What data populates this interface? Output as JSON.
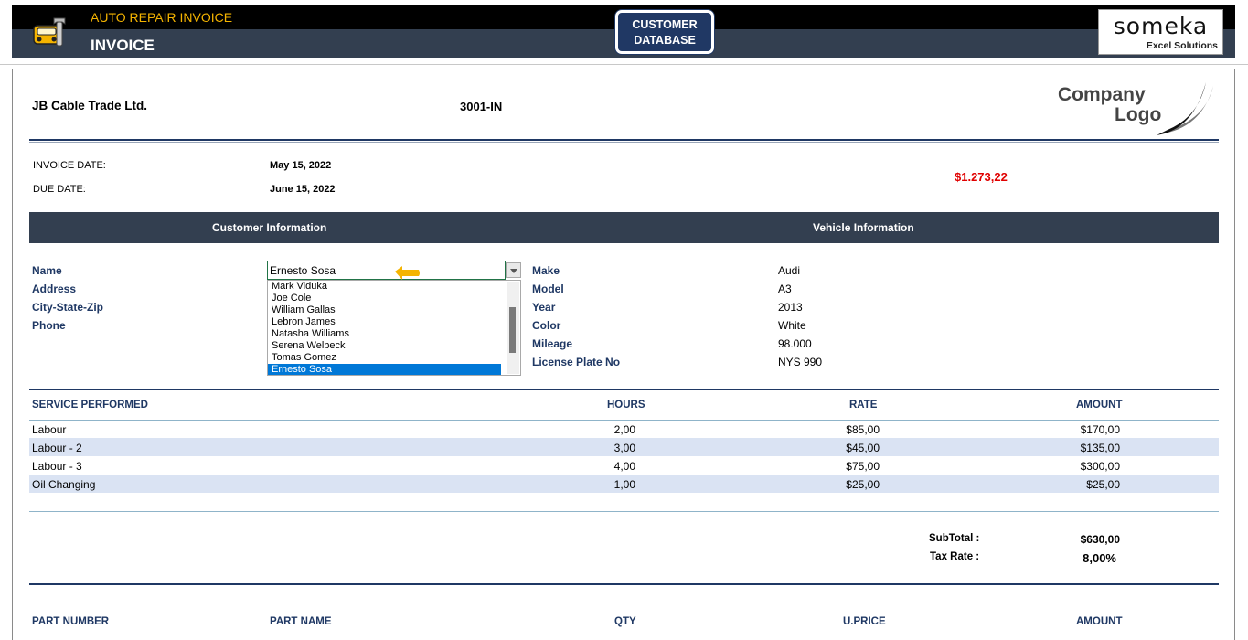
{
  "header": {
    "app_title": "AUTO REPAIR INVOICE",
    "page_name": "INVOICE",
    "customer_db_line1": "CUSTOMER",
    "customer_db_line2": "DATABASE",
    "brand_word": "someka",
    "brand_sub": "Excel Solutions"
  },
  "invoice": {
    "company": "JB Cable Trade Ltd.",
    "number": "3001-IN",
    "logo_line1": "Company",
    "logo_line2": "Logo",
    "date_label": "INVOICE DATE:",
    "date_value": "May 15, 2022",
    "due_label": "DUE DATE:",
    "due_value": "June 15, 2022",
    "total": "$1.273,22"
  },
  "sections": {
    "customer": "Customer Information",
    "vehicle": "Vehicle Information"
  },
  "customer": {
    "labels": [
      "Name",
      "Address",
      "City-State-Zip",
      "Phone"
    ],
    "name_value": "Ernesto Sosa",
    "dropdown_options": [
      "Mark Viduka",
      "Joe Cole",
      "William Gallas",
      "Lebron James",
      "Natasha Williams",
      "Serena Welbeck",
      "Tomas Gomez",
      "Ernesto Sosa"
    ],
    "selected_index": 7
  },
  "vehicle": {
    "fields": [
      {
        "label": "Make",
        "value": "Audi"
      },
      {
        "label": "Model",
        "value": "A3"
      },
      {
        "label": "Year",
        "value": "2013"
      },
      {
        "label": "Color",
        "value": "White"
      },
      {
        "label": "Mileage",
        "value": "98.000"
      },
      {
        "label": "License Plate No",
        "value": "NYS 990"
      }
    ]
  },
  "services": {
    "headers": [
      "SERVICE PERFORMED",
      "HOURS",
      "RATE",
      "AMOUNT"
    ],
    "rows": [
      {
        "name": "Labour",
        "hours": "2,00",
        "rate": "$85,00",
        "amount": "$170,00"
      },
      {
        "name": "Labour - 2",
        "hours": "3,00",
        "rate": "$45,00",
        "amount": "$135,00"
      },
      {
        "name": "Labour - 3",
        "hours": "4,00",
        "rate": "$75,00",
        "amount": "$300,00"
      },
      {
        "name": "Oil Changing",
        "hours": "1,00",
        "rate": "$25,00",
        "amount": "$25,00"
      }
    ],
    "subtotal_label": "SubTotal :",
    "subtotal_value": "$630,00",
    "taxrate_label": "Tax Rate :",
    "taxrate_value": "8,00%"
  },
  "parts": {
    "headers": [
      "PART NUMBER",
      "PART NAME",
      "QTY",
      "U.PRICE",
      "AMOUNT"
    ]
  },
  "colors": {
    "header_bg": "#333f50",
    "navy": "#1f3864",
    "accent_orange": "#f5b400",
    "total_red": "#e00000",
    "stripe": "#dae3f3",
    "selection_blue": "#0078d7"
  }
}
